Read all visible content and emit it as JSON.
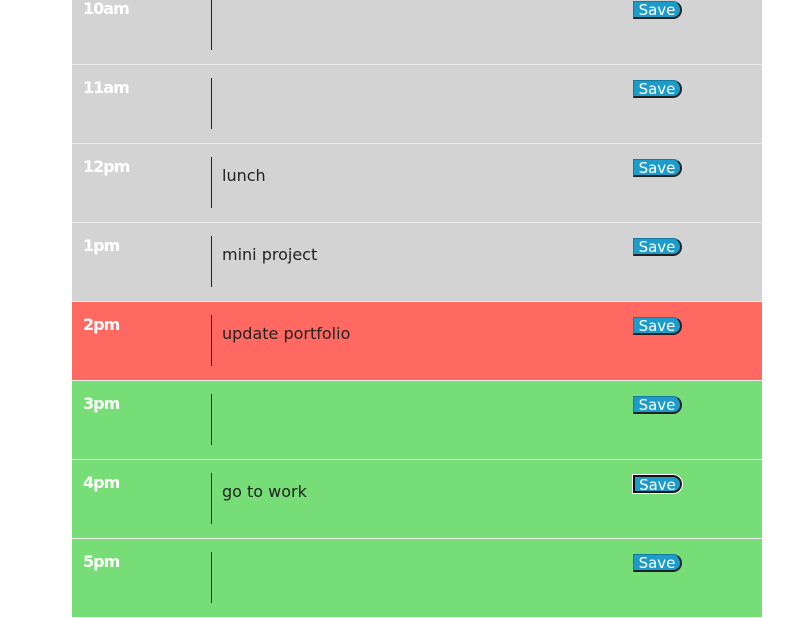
{
  "save_label": "Save",
  "colors": {
    "past": "#d3d3d3",
    "present": "#ff6961",
    "future": "#77dd77",
    "save_button": "#1d9cc9"
  },
  "rows": [
    {
      "hour": "10am",
      "task": "",
      "state": "past"
    },
    {
      "hour": "11am",
      "task": "",
      "state": "past"
    },
    {
      "hour": "12pm",
      "task": "lunch",
      "state": "past"
    },
    {
      "hour": "1pm",
      "task": "mini project",
      "state": "past"
    },
    {
      "hour": "2pm",
      "task": "update portfolio",
      "state": "present"
    },
    {
      "hour": "3pm",
      "task": "",
      "state": "future"
    },
    {
      "hour": "4pm",
      "task": "go to work",
      "state": "future",
      "focused": true
    },
    {
      "hour": "5pm",
      "task": "",
      "state": "future"
    }
  ]
}
